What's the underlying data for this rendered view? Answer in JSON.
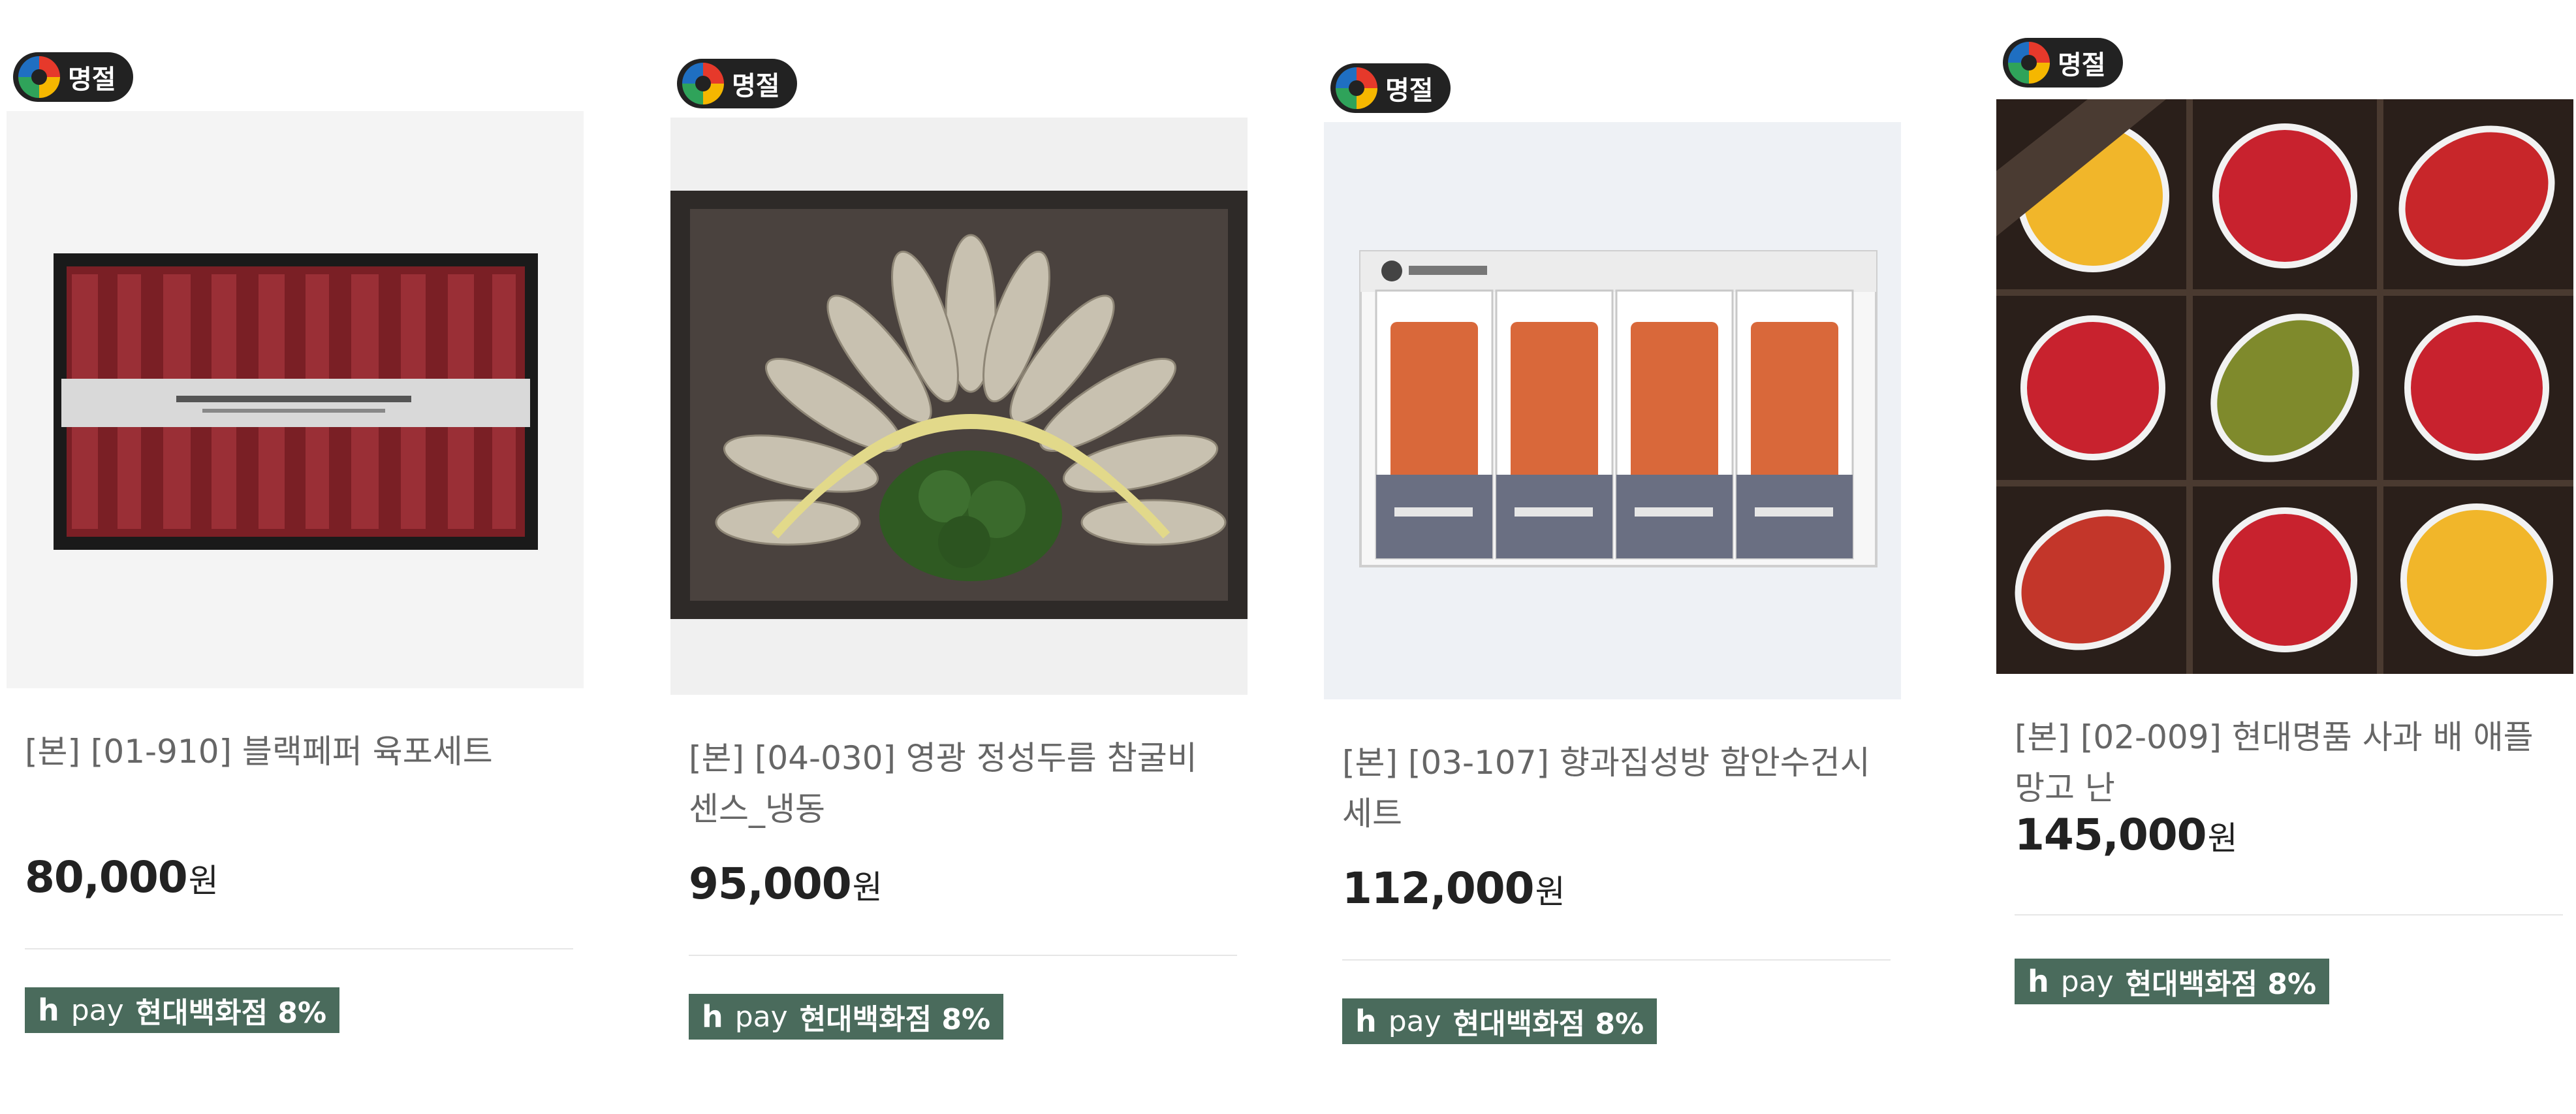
{
  "products": [
    {
      "badge": "명절",
      "image": "beef-jerky-gift-box",
      "name": "[본] [01-910] 블랙페퍼 육포세트",
      "price": "80,000",
      "unit": "원",
      "payment": {
        "brand": "h",
        "pay": "pay",
        "benefit": "현대백화점 8%"
      }
    },
    {
      "badge": "명절",
      "image": "dried-croaker-gift-box",
      "name": "[본] [04-030] 영광 정성두름 참굴비 센스_냉동",
      "price": "95,000",
      "unit": "원",
      "payment": {
        "brand": "h",
        "pay": "pay",
        "benefit": "현대백화점 8%"
      }
    },
    {
      "badge": "명절",
      "image": "dried-persimmon-gift-box",
      "name": "[본] [03-107] 향과집성방 함안수건시 세트",
      "price": "112,000",
      "unit": "원",
      "payment": {
        "brand": "h",
        "pay": "pay",
        "benefit": "현대백화점 8%"
      }
    },
    {
      "badge": "명절",
      "image": "fruit-gift-box",
      "name": "[본] [02-009] 현대명품 사과 배 애플망고 난",
      "price": "145,000",
      "unit": "원",
      "payment": {
        "brand": "h",
        "pay": "pay",
        "benefit": "현대백화점 8%"
      }
    }
  ]
}
